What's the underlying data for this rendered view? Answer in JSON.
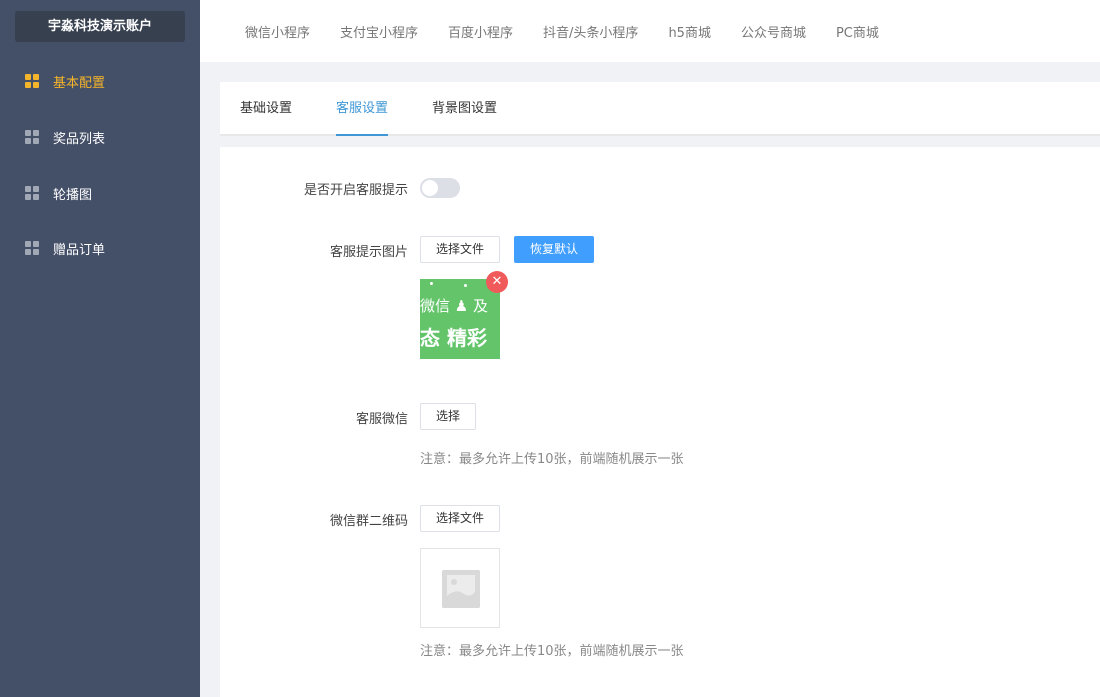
{
  "sidebar": {
    "account": "宇淼科技演示账户",
    "items": [
      {
        "label": "基本配置"
      },
      {
        "label": "奖品列表"
      },
      {
        "label": "轮播图"
      },
      {
        "label": "赠品订单"
      }
    ]
  },
  "topnav": {
    "tabs": [
      {
        "label": "微信小程序"
      },
      {
        "label": "支付宝小程序"
      },
      {
        "label": "百度小程序"
      },
      {
        "label": "抖音/头条小程序"
      },
      {
        "label": "h5商城"
      },
      {
        "label": "公众号商城"
      },
      {
        "label": "PC商城"
      }
    ]
  },
  "subtabs": [
    {
      "label": "基础设置"
    },
    {
      "label": "客服设置"
    },
    {
      "label": "背景图设置"
    }
  ],
  "form": {
    "cs_tip_switch_label": "是否开启客服提示",
    "cs_tip_image_label": "客服提示图片",
    "choose_file": "选择文件",
    "restore_default": "恢复默认",
    "thumb_line1": "微信 ♟ 及",
    "thumb_line2": "态 精彩",
    "delete_glyph": "✕",
    "cs_wechat_label": "客服微信",
    "choose": "选择",
    "note1": "注意：最多允许上传10张，前端随机展示一张",
    "group_qr_label": "微信群二维码",
    "choose_file2": "选择文件",
    "note2": "注意：最多允许上传10张，前端随机展示一张"
  },
  "colors": {
    "sidebar_bg": "#444f68",
    "active_accent": "#f5b52a",
    "primary": "#409eff",
    "tab_active": "#3f97d6",
    "thumb_green": "#63c46a",
    "delete_red": "#f05a5a"
  },
  "icons": {
    "sidebar_item": "grid-icon",
    "delete": "close-icon",
    "placeholder": "image-placeholder-icon"
  }
}
